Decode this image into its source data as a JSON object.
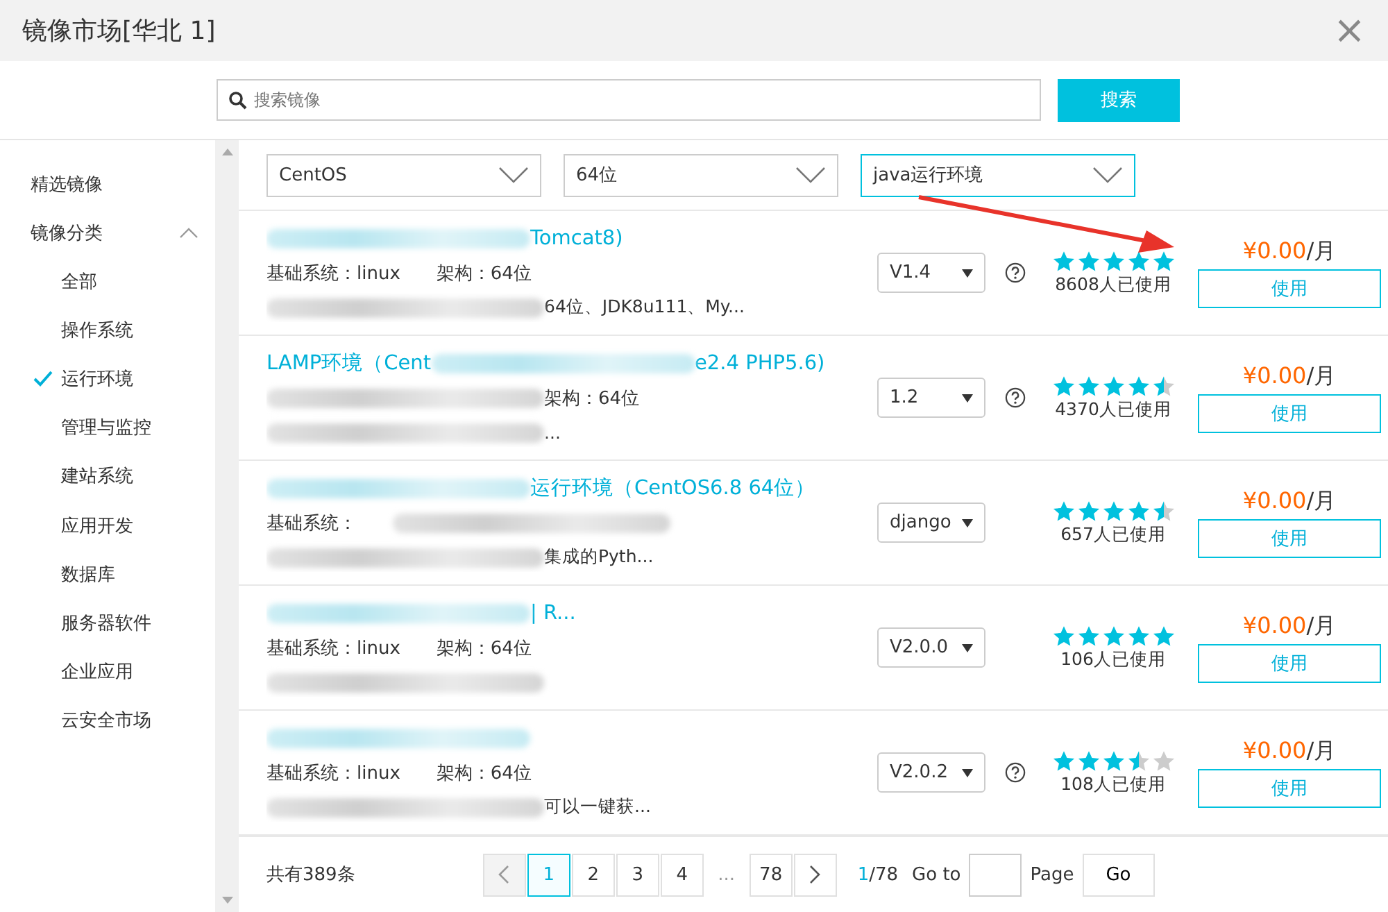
{
  "window": {
    "title": "镜像市场[华北 1]",
    "close": "×"
  },
  "search": {
    "placeholder": "搜索镜像",
    "button": "搜索"
  },
  "sidebar": {
    "items": [
      {
        "label": "精选镜像",
        "selected": false
      },
      {
        "label": "镜像分类",
        "selected": false,
        "expanded": true,
        "children": [
          {
            "label": "全部",
            "selected": false
          },
          {
            "label": "操作系统",
            "selected": false
          },
          {
            "label": "运行环境",
            "selected": true
          },
          {
            "label": "管理与监控",
            "selected": false
          },
          {
            "label": "建站系统",
            "selected": false
          },
          {
            "label": "应用开发",
            "selected": false
          },
          {
            "label": "数据库",
            "selected": false
          },
          {
            "label": "服务器软件",
            "selected": false
          },
          {
            "label": "企业应用",
            "selected": false
          },
          {
            "label": "云安全市场",
            "selected": false
          }
        ]
      }
    ]
  },
  "filters": [
    {
      "value": "CentOS",
      "selected": false
    },
    {
      "value": "64位",
      "selected": false
    },
    {
      "value": "java运行环境",
      "selected": true
    }
  ],
  "images": [
    {
      "title": [
        {
          "kind": "blur"
        },
        {
          "kind": "text",
          "text": "Tomcat8)"
        }
      ],
      "specs": [
        {
          "kind": "text",
          "text": "基础系统：linux"
        },
        {
          "kind": "text",
          "text": "架构：64位"
        }
      ],
      "description": [
        {
          "kind": "blur"
        },
        {
          "kind": "text",
          "text": "64位、JDK8u111、My..."
        }
      ],
      "version": "V1.4",
      "help": true,
      "stars": 5,
      "users": "8608人已使用",
      "price": "¥0.00",
      "unit": "/月",
      "button": "使用"
    },
    {
      "title": [
        {
          "kind": "text",
          "text": "LAMP环境（Cent"
        },
        {
          "kind": "blur"
        },
        {
          "kind": "text",
          "text": "e2.4 PHP5.6)"
        }
      ],
      "specs": [
        {
          "kind": "blur"
        },
        {
          "kind": "text",
          "text": "架构：64位"
        }
      ],
      "description": [
        {
          "kind": "blur"
        },
        {
          "kind": "text",
          "text": "..."
        }
      ],
      "version": "1.2",
      "help": true,
      "stars": 4.5,
      "users": "4370人已使用",
      "price": "¥0.00",
      "unit": "/月",
      "button": "使用"
    },
    {
      "title": [
        {
          "kind": "blur"
        },
        {
          "kind": "text",
          "text": "运行环境（CentOS6.8 64位）"
        }
      ],
      "specs": [
        {
          "kind": "text",
          "text": "基础系统："
        },
        {
          "kind": "blur"
        }
      ],
      "description": [
        {
          "kind": "blur"
        },
        {
          "kind": "text",
          "text": "集成的Pyth..."
        }
      ],
      "version": "django",
      "help": false,
      "stars": 4.5,
      "users": "657人已使用",
      "price": "¥0.00",
      "unit": "/月",
      "button": "使用"
    },
    {
      "title": [
        {
          "kind": "blur"
        },
        {
          "kind": "text",
          "text": "| R..."
        }
      ],
      "specs": [
        {
          "kind": "text",
          "text": "基础系统：linux"
        },
        {
          "kind": "text",
          "text": "架构：64位"
        }
      ],
      "description": [
        {
          "kind": "blur"
        }
      ],
      "version": "V2.0.0",
      "help": false,
      "stars": 5,
      "users": "106人已使用",
      "price": "¥0.00",
      "unit": "/月",
      "button": "使用"
    },
    {
      "title": [
        {
          "kind": "blur"
        }
      ],
      "specs": [
        {
          "kind": "text",
          "text": "基础系统：linux"
        },
        {
          "kind": "text",
          "text": "架构：64位"
        }
      ],
      "description": [
        {
          "kind": "blur"
        },
        {
          "kind": "text",
          "text": "可以一键获..."
        }
      ],
      "version": "V2.0.2",
      "help": true,
      "stars": 3.5,
      "users": "108人已使用",
      "price": "¥0.00",
      "unit": "/月",
      "button": "使用"
    }
  ],
  "footer": {
    "total": "共有389条",
    "pages": [
      {
        "label": "1",
        "selected": true
      },
      {
        "label": "2",
        "selected": false
      },
      {
        "label": "3",
        "selected": false
      },
      {
        "label": "4",
        "selected": false
      },
      {
        "label": "...",
        "kind": "gap"
      },
      {
        "label": "78",
        "selected": false
      }
    ],
    "current": "1",
    "page_count": "/78",
    "goto": "Go to",
    "page_label": "Page",
    "go": "Go"
  }
}
